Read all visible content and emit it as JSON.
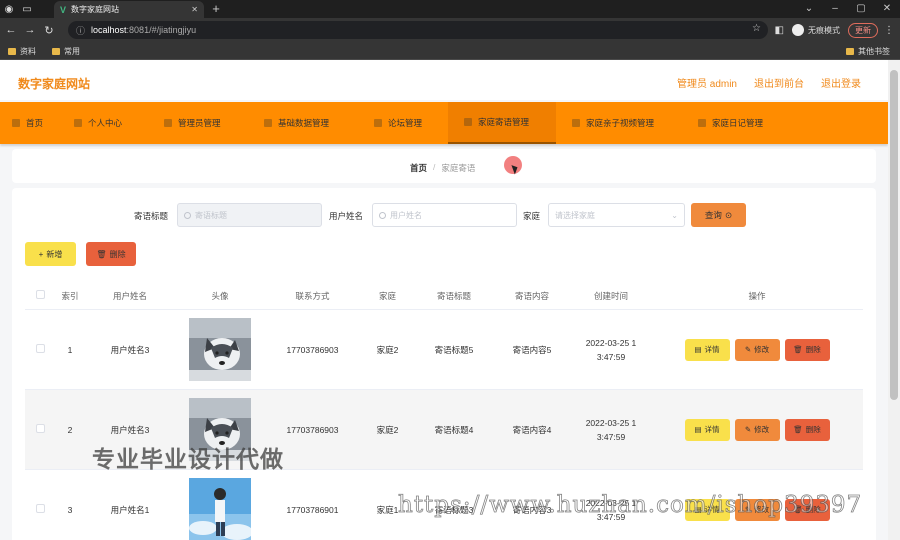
{
  "browser": {
    "tab_title": "数字家庭网站",
    "url_host": "localhost",
    "url_rest": ":8081/#/jiatingjiyu",
    "incognito_label": "无痕模式",
    "update_label": "更新",
    "bookmarks": [
      "资料",
      "常用"
    ],
    "other_bookmarks": "其他书签"
  },
  "site": {
    "title": "数字家庭网站",
    "header_links": [
      "管理员 admin",
      "退出到前台",
      "退出登录"
    ]
  },
  "nav": {
    "items": [
      "首页",
      "个人中心",
      "管理员管理",
      "基础数据管理",
      "论坛管理",
      "家庭寄语管理",
      "家庭亲子视频管理",
      "家庭日记管理"
    ],
    "active_index": 5
  },
  "breadcrumb": {
    "home": "首页",
    "separator": "/",
    "current": "家庭寄语"
  },
  "search": {
    "title_label": "寄语标题",
    "title_placeholder": "寄语标题",
    "user_label": "用户姓名",
    "user_placeholder": "用户姓名",
    "family_label": "家庭",
    "family_placeholder": "请选择家庭",
    "query_label": "查询"
  },
  "actions": {
    "add_label": "新增",
    "delete_label": "删除"
  },
  "table": {
    "headers": [
      "索引",
      "用户姓名",
      "头像",
      "联系方式",
      "家庭",
      "寄语标题",
      "寄语内容",
      "创建时间",
      "操作"
    ],
    "op_labels": {
      "detail": "详情",
      "edit": "修改",
      "delete": "删除"
    },
    "rows": [
      {
        "index": "1",
        "name": "用户姓名3",
        "phone": "17703786903",
        "family": "家庭2",
        "title": "寄语标题5",
        "content": "寄语内容5",
        "time_line1": "2022-03-25 1",
        "time_line2": "3:47:59"
      },
      {
        "index": "2",
        "name": "用户姓名3",
        "phone": "17703786903",
        "family": "家庭2",
        "title": "寄语标题4",
        "content": "寄语内容4",
        "time_line1": "2022-03-25 1",
        "time_line2": "3:47:59"
      },
      {
        "index": "3",
        "name": "用户姓名1",
        "phone": "17703786901",
        "family": "家庭1",
        "title": "寄语标题3",
        "content": "寄语内容3",
        "time_line1": "2022-03-25 1",
        "time_line2": "3:47:59"
      }
    ]
  },
  "watermarks": {
    "line1": "专业毕业设计代做",
    "line2": "https://www.huzhan.com/ishop39397"
  },
  "colors": {
    "accent": "#ff8c00",
    "title": "#f08a1c",
    "add": "#f9e04b",
    "delete": "#e8613c",
    "query": "#f08a3c"
  }
}
